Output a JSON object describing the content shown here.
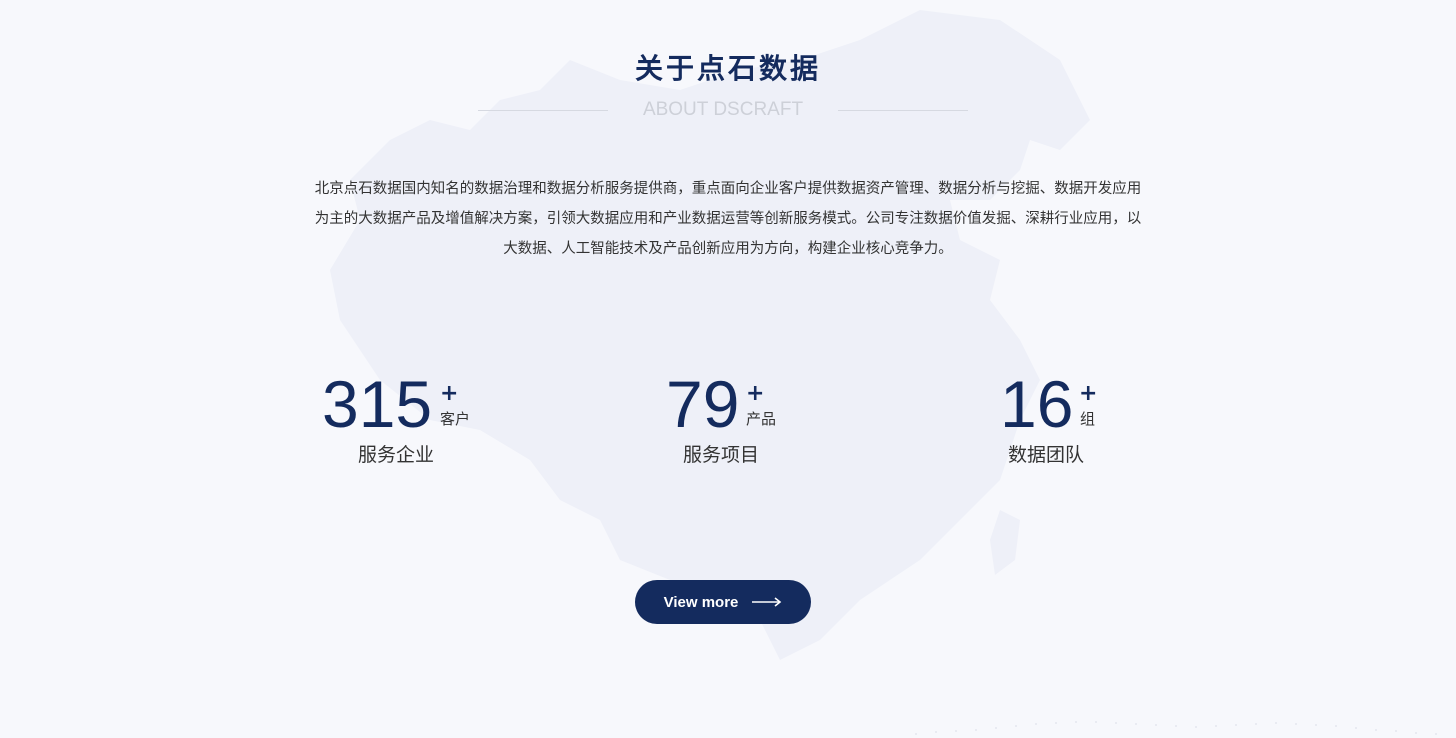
{
  "section": {
    "title": "关于点石数据",
    "subtitle": "ABOUT DSCRAFT",
    "intro_lines": [
      "北京点石数据国内知名的数据治理和数据分析服务提供商，重点面向企业客户提供数据资产管理、数据分析与挖掘、数据开发应用",
      "为主的大数据产品及增值解决方案，引领大数据应用和产业数据运营等创新服务模式。公司专注数据价值发掘、深耕行业应用，以",
      "大数据、人工智能技术及产品创新应用为方向，构建企业核心竞争力。"
    ]
  },
  "stats": [
    {
      "number": "315",
      "plus": "+",
      "unit": "客户",
      "label": "服务企业"
    },
    {
      "number": "79",
      "plus": "+",
      "unit": "产品",
      "label": "服务项目"
    },
    {
      "number": "16",
      "plus": "+",
      "unit": "组",
      "label": "数据团队"
    }
  ],
  "button": {
    "label": "View more",
    "icon": "arrow-right-icon"
  },
  "colors": {
    "primary": "#142b5e",
    "background": "#f7f8fc",
    "map": "#eceef8"
  }
}
